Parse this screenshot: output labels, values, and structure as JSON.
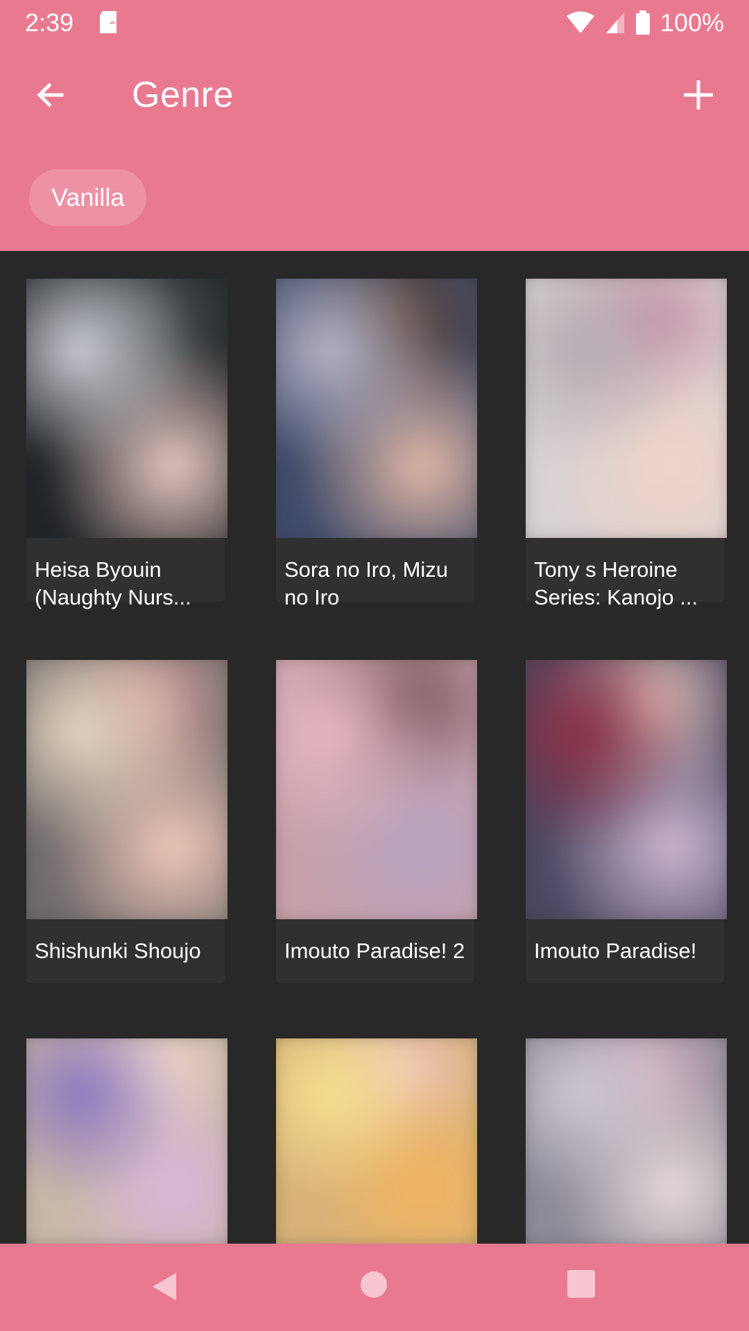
{
  "status_bar": {
    "time": "2:39",
    "battery": "100%"
  },
  "app_bar": {
    "title": "Genre",
    "chip": "Vanilla"
  },
  "nav_icons": [
    "back-arrow-icon",
    "add-icon"
  ],
  "items": [
    {
      "title": "Heisa Byouin (Naughty Nurs...",
      "palette": [
        "#1f2326",
        "#cfd0d8",
        "#e9c9c3",
        "#4b5254"
      ]
    },
    {
      "title": "Sora no Iro, Mizu no Iro",
      "palette": [
        "#3e4a6a",
        "#b9b6c9",
        "#e3b9a6",
        "#5b4232"
      ]
    },
    {
      "title": "Tony s Heroine Series: Kanojo ...",
      "palette": [
        "#d8d2d4",
        "#b6aeb5",
        "#f2d4c6",
        "#c88fa6"
      ]
    },
    {
      "title": "Shishunki Shoujo",
      "palette": [
        "#6f6a6c",
        "#e6d7bf",
        "#f2c9b8",
        "#d9a4a0"
      ]
    },
    {
      "title": "Imouto Paradise! 2",
      "palette": [
        "#c8a0a9",
        "#e6b7c2",
        "#b7a4c0",
        "#6f4a52"
      ]
    },
    {
      "title": "Imouto Paradise!",
      "palette": [
        "#4c4660",
        "#8a2f45",
        "#cdb9d4",
        "#f1d0c6"
      ]
    },
    {
      "title": "",
      "palette": [
        "#c9b7a6",
        "#8a78c1",
        "#d9b6dc",
        "#f3d8d2"
      ]
    },
    {
      "title": "",
      "palette": [
        "#d8b27a",
        "#f7e08e",
        "#f1b45f",
        "#f1c8c3"
      ]
    },
    {
      "title": "",
      "palette": [
        "#8f8a98",
        "#cfcad4",
        "#e7dada",
        "#d9b5c5"
      ]
    }
  ],
  "colors": {
    "primary": "#e97990",
    "background": "#282828",
    "card": "#303030"
  }
}
